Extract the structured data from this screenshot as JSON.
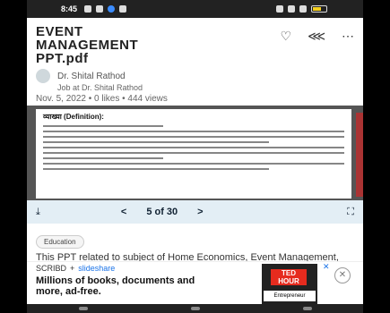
{
  "status": {
    "time": "8:45"
  },
  "doc": {
    "title": "EVENT MANAGEMENT PPT.pdf",
    "author": "Dr. Shital Rathod",
    "job": "Job at Dr. Shital Rathod",
    "meta": "Nov. 5, 2022 • 0 likes • 444 views"
  },
  "slide": {
    "heading": "व्याख्या (Definition):"
  },
  "toolbar": {
    "prev": "<",
    "page": "5 of 30",
    "next": ">"
  },
  "below": {
    "category": "Education",
    "description": "This PPT related to subject of Home Economics, Event Management, Home"
  },
  "ad": {
    "brand1": "SCRIBD",
    "plus": "+",
    "brand2": "slideshare",
    "text": "Millions of books, documents and more, ad-free.",
    "ted": "TED HOUR",
    "ent": "Entrepreneur"
  },
  "icons": [
    "heart-icon",
    "share-icon",
    "more-icon",
    "download-icon",
    "fullscreen-icon",
    "close-icon"
  ]
}
